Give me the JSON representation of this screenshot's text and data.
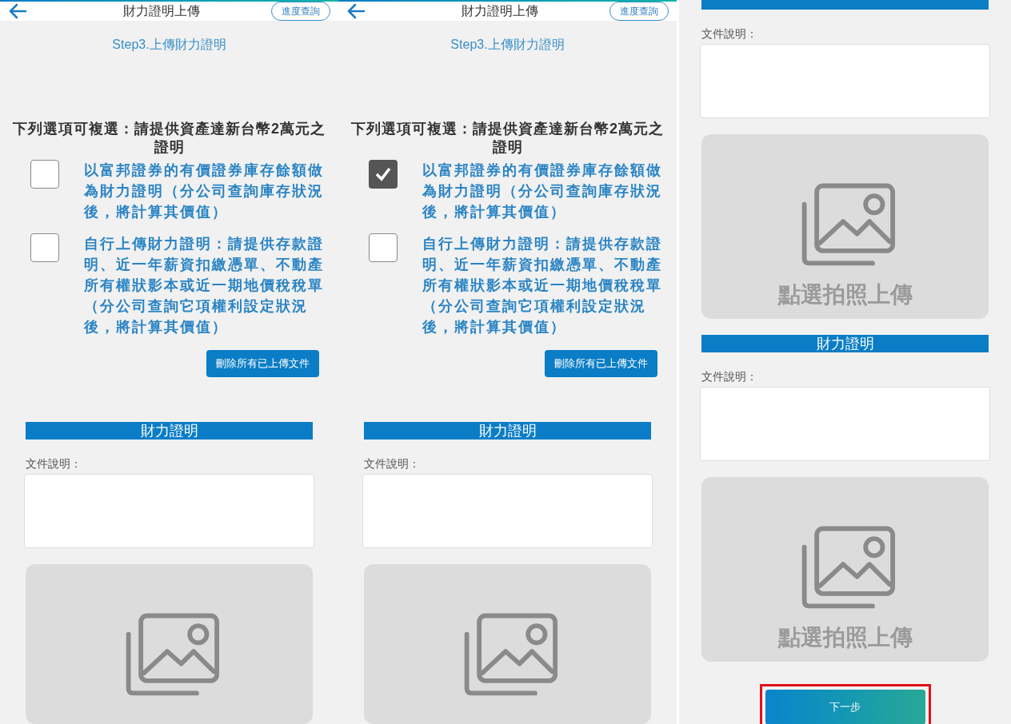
{
  "panels": [
    {
      "kind": "form",
      "header": {
        "title": "財力證明上傳",
        "status_button": "進度查詢"
      },
      "step": "Step3.上傳財力證明",
      "prompt": "下列選項可複選：請提供資產達新台幣2萬元之證明",
      "options": [
        {
          "text": "以富邦證券的有價證券庫存餘額做為財力證明（分公司查詢庫存狀況後，將計算其價值）",
          "checked": false
        },
        {
          "text": "自行上傳財力證明：請提供存款證明、近一年薪資扣繳憑單、不動產所有權狀影本或近一期地價稅稅單（分公司查詢它項權利設定狀況後，將計算其價值）",
          "checked": false
        }
      ],
      "delete_button": "刪除所有已上傳文件",
      "sections": [
        {
          "title": "財力證明",
          "field_label": "文件說明："
        }
      ]
    },
    {
      "kind": "form",
      "header": {
        "title": "財力證明上傳",
        "status_button": "進度查詢"
      },
      "step": "Step3.上傳財力證明",
      "prompt": "下列選項可複選：請提供資產達新台幣2萬元之證明",
      "options": [
        {
          "text": "以富邦證券的有價證券庫存餘額做為財力證明（分公司查詢庫存狀況後，將計算其價值）",
          "checked": true
        },
        {
          "text": "自行上傳財力證明：請提供存款證明、近一年薪資扣繳憑單、不動產所有權狀影本或近一期地價稅稅單（分公司查詢它項權利設定狀況後，將計算其價值）",
          "checked": false
        }
      ],
      "delete_button": "刪除所有已上傳文件",
      "sections": [
        {
          "title": "財力證明",
          "field_label": "文件說明："
        }
      ]
    },
    {
      "kind": "continuation",
      "sections": [
        {
          "field_label": "文件說明：",
          "upload_caption": "點選拍照上傳"
        },
        {
          "title": "財力證明",
          "field_label": "文件說明：",
          "upload_caption": "點選拍照上傳"
        }
      ],
      "next_button": {
        "label": "下一步",
        "highlighted": true
      }
    }
  ]
}
